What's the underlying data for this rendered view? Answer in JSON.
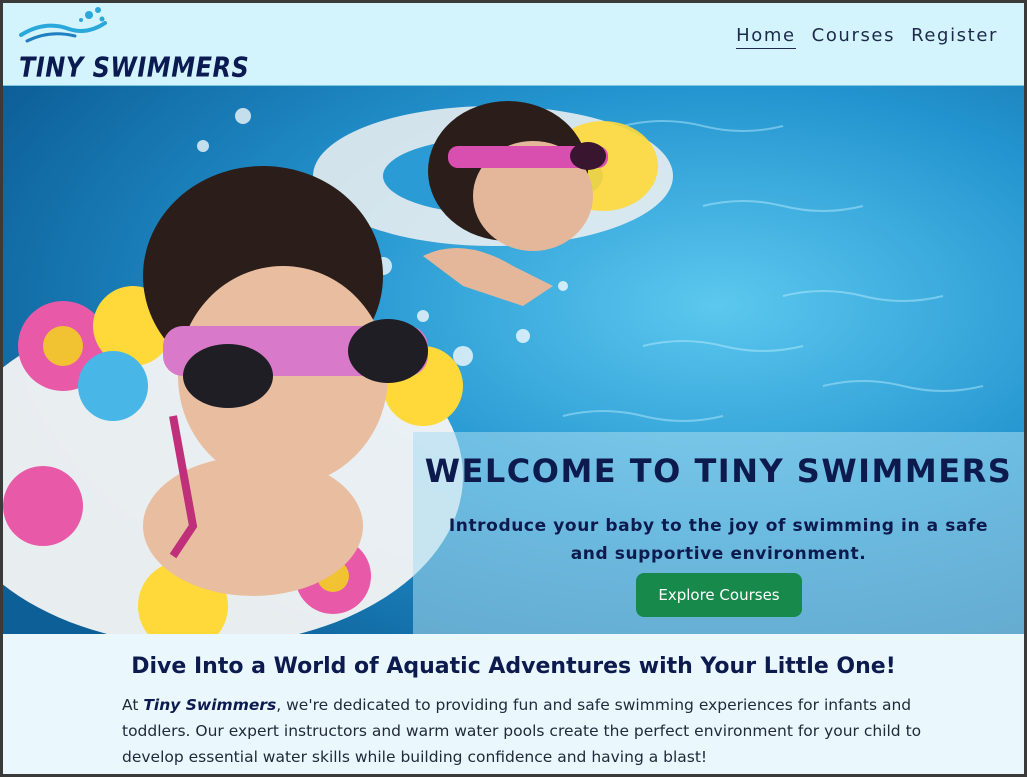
{
  "brand": {
    "name": "TINY SWIMMERS"
  },
  "nav": {
    "items": [
      {
        "label": "Home",
        "active": true
      },
      {
        "label": "Courses",
        "active": false
      },
      {
        "label": "Register",
        "active": false
      }
    ]
  },
  "hero": {
    "title": "WELCOME TO TINY SWIMMERS",
    "subtitle": "Introduce your baby to the joy of swimming in a safe and supportive environment.",
    "cta_label": "Explore Courses"
  },
  "intro": {
    "heading": "Dive Into a World of Aquatic Adventures with Your Little One!",
    "text_prefix": "At ",
    "text_brand": "Tiny Swimmers",
    "text_body": ", we're dedicated to providing fun and safe swimming experiences for infants and toddlers. Our expert instructors and warm water pools create the perfect environment for your child to develop essential water skills while building confidence and having a blast!"
  },
  "colors": {
    "nav_bg": "#d3f3fd",
    "page_bg": "#eaf8fe",
    "heading_navy": "#0c1a4e",
    "cta_green": "#17894a"
  },
  "icons": {
    "logo": "water-waves-icon"
  }
}
